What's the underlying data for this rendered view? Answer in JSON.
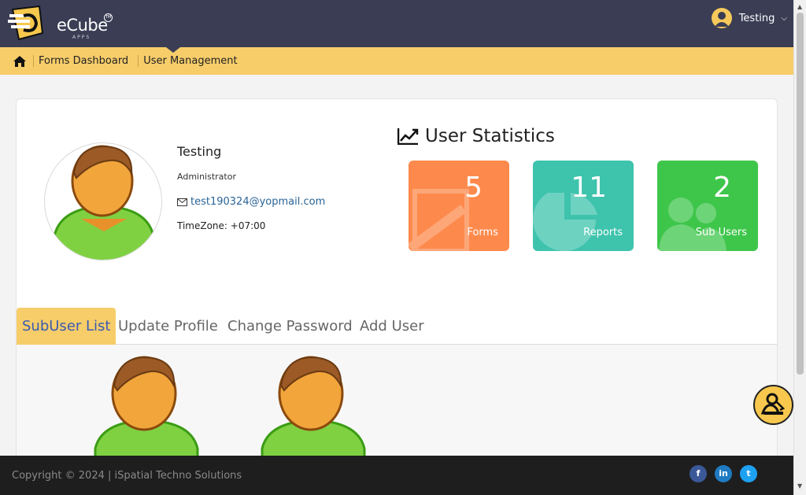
{
  "brand": {
    "name": "eCube",
    "sub": "APPS",
    "tm": "TM"
  },
  "user_menu": {
    "name": "Testing"
  },
  "breadcrumb": {
    "items": [
      "Forms Dashboard",
      "User Management"
    ]
  },
  "profile": {
    "name": "Testing",
    "role": "Administrator",
    "email": "test190324@yopmail.com",
    "timezone": "TimeZone: +07:00"
  },
  "stats": {
    "title": "User Statistics",
    "tiles": [
      {
        "value": "5",
        "label": "Forms",
        "color": "#fd8a4c"
      },
      {
        "value": "11",
        "label": "Reports",
        "color": "#3ec3ad"
      },
      {
        "value": "2",
        "label": "Sub Users",
        "color": "#3ec64b"
      }
    ]
  },
  "tabs": [
    "SubUser List",
    "Update Profile",
    "Change Password",
    "Add User"
  ],
  "active_tab": "SubUser List",
  "footer": {
    "copyright": "Copyright © 2024 | iSpatial Techno Solutions"
  },
  "social": [
    {
      "label": "f",
      "icon": "facebook-icon"
    },
    {
      "label": "in",
      "icon": "linkedin-icon"
    },
    {
      "label": "t",
      "icon": "twitter-icon"
    }
  ],
  "colors": {
    "topbar": "#3a3d54",
    "accent": "#f7cd6a",
    "link": "#2a6496",
    "tab_active_text": "#3b5bb0"
  }
}
